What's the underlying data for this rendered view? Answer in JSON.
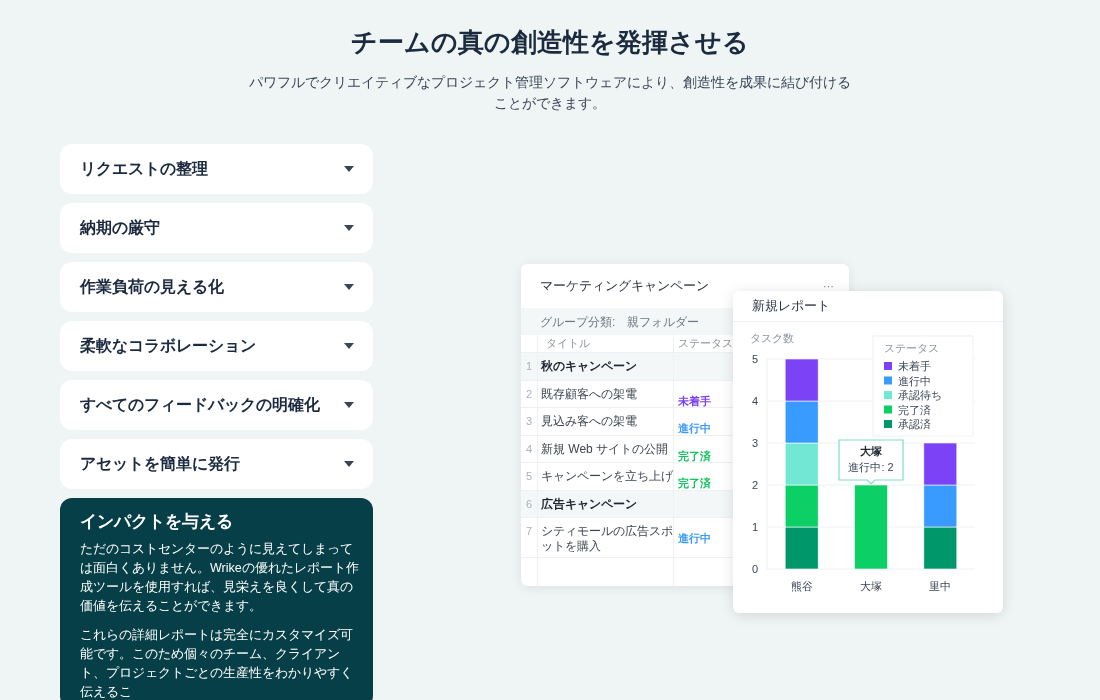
{
  "heading": "チームの真の創造性を発揮させる",
  "subheading": "パワフルでクリエイティブなプロジェクト管理ソフトウェアにより、創造性を成果に結び付けることができます。",
  "accordion": [
    {
      "label": "リクエストの整理",
      "expanded": false
    },
    {
      "label": "納期の厳守",
      "expanded": false
    },
    {
      "label": "作業負荷の見える化",
      "expanded": false
    },
    {
      "label": "柔軟なコラボレーション",
      "expanded": false
    },
    {
      "label": "すべてのフィードバックの明確化",
      "expanded": false
    },
    {
      "label": "アセットを簡単に発行",
      "expanded": false
    },
    {
      "label": "インパクトを与える",
      "expanded": true,
      "paragraphs": [
        "ただのコストセンターのように見えてしまっては面白くありません。Wrikeの優れたレポート作成ツールを使用すれば、見栄えを良くして真の価値を伝えることができます。",
        "これらの詳細レポートは完全にカスタマイズ可能です。このため個々のチーム、クライアント、プロジェクトごとの生産性をわかりやすく伝えるこ"
      ]
    }
  ],
  "task_card": {
    "title": "マーケティングキャンペーン",
    "menu": "···",
    "group_by": "グループ分類:　親フォルダー",
    "columns": [
      "タイトル",
      "ステータス"
    ],
    "rows": [
      {
        "kind": "group",
        "number": "1",
        "title": "秋のキャンペーン"
      },
      {
        "kind": "task",
        "number": "2",
        "title": "既存顧客への架電",
        "status": "未着手",
        "color": "#7b3ff2"
      },
      {
        "kind": "task",
        "number": "3",
        "title": "見込み客への架電",
        "status": "進行中",
        "color": "#3a9bf5"
      },
      {
        "kind": "task",
        "number": "4",
        "title": "新規 Web サイトの公開",
        "status": "完了済",
        "color": "#14c45f"
      },
      {
        "kind": "task",
        "number": "5",
        "title": "キャンペーンを立ち上げ",
        "status": "完了済",
        "color": "#14c45f"
      },
      {
        "kind": "group",
        "number": "6",
        "title": "広告キャンペーン"
      },
      {
        "kind": "task",
        "number": "7",
        "title": "シティモールの広告スポットを購入",
        "status": "進行中",
        "color": "#3a9bf5"
      }
    ]
  },
  "report_card": {
    "title": "新規レポート",
    "chart_data": {
      "type": "bar",
      "stacked": true,
      "ylabel": "タスク数",
      "categories": [
        "熊谷",
        "大塚",
        "里中"
      ],
      "yticks": [
        {
          "value": 0,
          "label": "0"
        },
        {
          "value": 1,
          "label": "1"
        },
        {
          "value": 2,
          "label": "2"
        },
        {
          "value": 3,
          "label": "3"
        },
        {
          "value": 4,
          "label": "4"
        },
        {
          "value": 5,
          "label": "5"
        }
      ],
      "ylim": [
        0,
        5
      ],
      "grid": true,
      "legend": {
        "title": "ステータス"
      },
      "series": [
        {
          "name": "未着手",
          "color": "#7b42f6",
          "values": [
            1,
            0,
            1
          ]
        },
        {
          "name": "進行中",
          "color": "#3a9bff",
          "values": [
            1,
            0,
            1
          ]
        },
        {
          "name": "承認待ち",
          "color": "#72e8d4",
          "values": [
            1,
            0,
            0
          ]
        },
        {
          "name": "完了済",
          "color": "#0cd066",
          "values": [
            1,
            2,
            0
          ]
        },
        {
          "name": "承認済",
          "color": "#00976a",
          "values": [
            1,
            0,
            1
          ]
        }
      ]
    },
    "tooltip": {
      "title": "大塚",
      "text": "進行中: 2"
    }
  }
}
